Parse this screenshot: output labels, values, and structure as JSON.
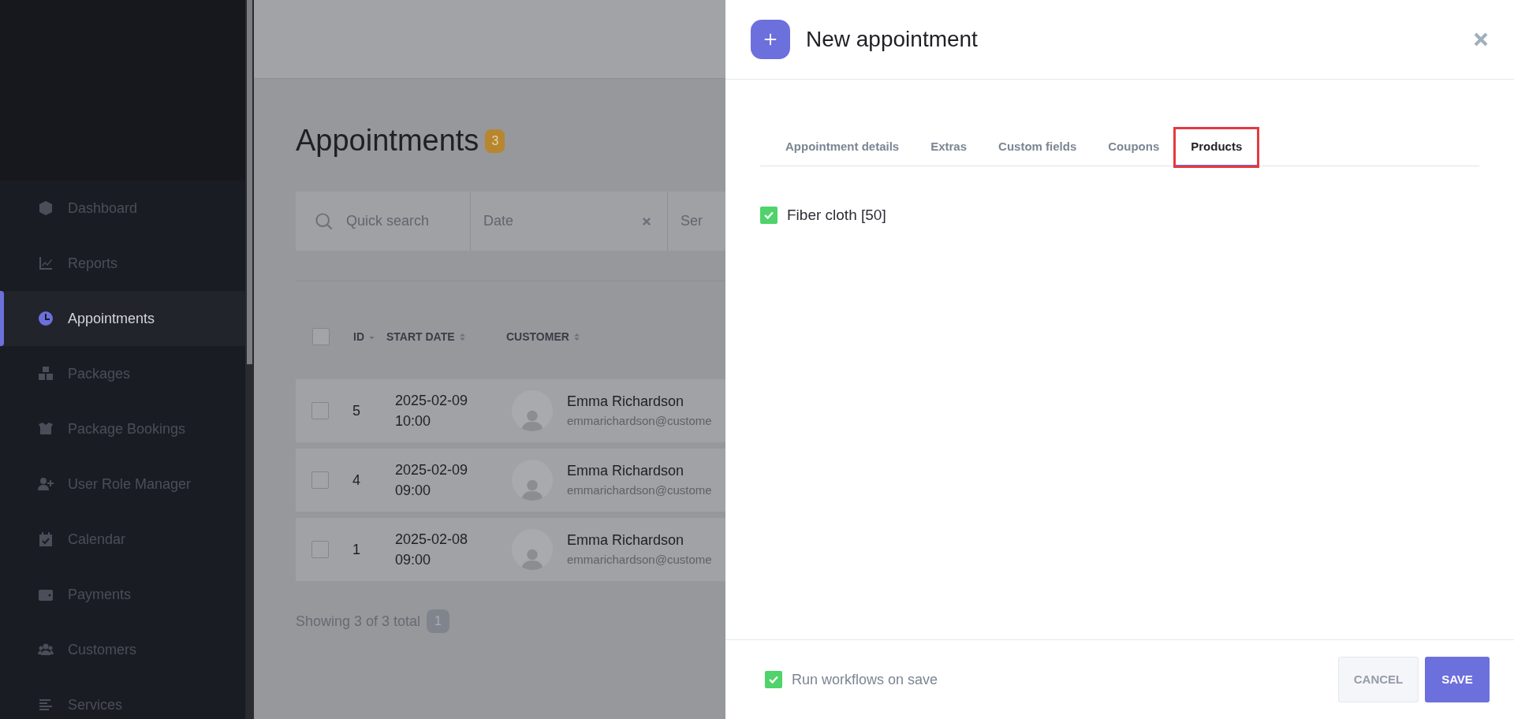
{
  "sidebar": {
    "items": [
      {
        "label": "Dashboard",
        "selected": false
      },
      {
        "label": "Reports",
        "selected": false
      },
      {
        "label": "Appointments",
        "selected": true
      },
      {
        "label": "Packages",
        "selected": false
      },
      {
        "label": "Package Bookings",
        "selected": false
      },
      {
        "label": "User Role Manager",
        "selected": false
      },
      {
        "label": "Calendar",
        "selected": false
      },
      {
        "label": "Payments",
        "selected": false
      },
      {
        "label": "Customers",
        "selected": false
      },
      {
        "label": "Services",
        "selected": false
      }
    ]
  },
  "main": {
    "title": "Appointments",
    "count": "3",
    "filters": [
      {
        "kind": "search",
        "placeholder": "Quick search"
      },
      {
        "kind": "date",
        "placeholder": "Date"
      },
      {
        "kind": "select",
        "placeholder": "Ser"
      }
    ],
    "table": {
      "all_selected": false,
      "columns": [
        {
          "label": "ID",
          "sorted": true
        },
        {
          "label": "START DATE",
          "sorted": false
        },
        {
          "label": "CUSTOMER",
          "sorted": false
        }
      ],
      "rows": [
        {
          "id": "5",
          "date": "2025-02-09",
          "time": "10:00",
          "name": "Emma Richardson",
          "email": "emmarichardson@custome",
          "selected": false
        },
        {
          "id": "4",
          "date": "2025-02-09",
          "time": "09:00",
          "name": "Emma Richardson",
          "email": "emmarichardson@custome",
          "selected": false
        },
        {
          "id": "1",
          "date": "2025-02-08",
          "time": "09:00",
          "name": "Emma Richardson",
          "email": "emmarichardson@custome",
          "selected": false
        }
      ]
    },
    "summary": "Showing 3 of 3 total",
    "page": "1"
  },
  "panel": {
    "title": "New appointment",
    "tabs": [
      {
        "label": "Appointment details",
        "selected": false,
        "highlighted": false
      },
      {
        "label": "Extras",
        "selected": false,
        "highlighted": false
      },
      {
        "label": "Custom fields",
        "selected": false,
        "highlighted": false
      },
      {
        "label": "Coupons",
        "selected": false,
        "highlighted": false
      },
      {
        "label": "Products",
        "selected": true,
        "highlighted": true
      }
    ],
    "products": [
      {
        "label": "Fiber cloth [50]",
        "checked": true
      }
    ],
    "run_workflows": {
      "label": "Run workflows on save",
      "checked": true
    },
    "buttons": [
      {
        "kind": "secondary",
        "label": "CANCEL"
      },
      {
        "kind": "primary",
        "label": "SAVE"
      }
    ]
  }
}
